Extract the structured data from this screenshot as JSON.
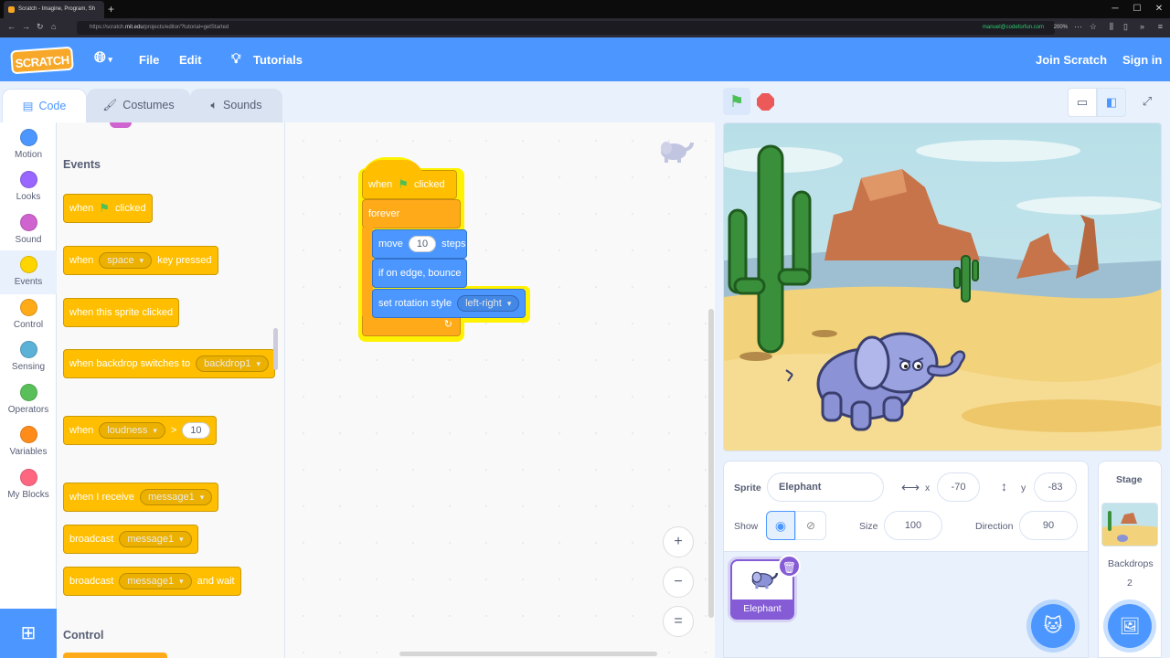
{
  "browser": {
    "tab_title": "Scratch - Imagine, Program, Sh",
    "url_prefix": "https://scratch.",
    "url_domain": "mit.edu",
    "url_suffix": "/projects/editor/?tutorial=getStarted",
    "account": "manuel@codeforfun.com",
    "zoom": "200%"
  },
  "menubar": {
    "logo": "SCRATCH",
    "file": "File",
    "edit": "Edit",
    "tutorials": "Tutorials",
    "join": "Join Scratch",
    "signin": "Sign in"
  },
  "tabs": {
    "code": "Code",
    "costumes": "Costumes",
    "sounds": "Sounds"
  },
  "categories": [
    {
      "label": "Motion",
      "color": "#4c97ff"
    },
    {
      "label": "Looks",
      "color": "#9966ff"
    },
    {
      "label": "Sound",
      "color": "#cf63cf"
    },
    {
      "label": "Events",
      "color": "#ffd500"
    },
    {
      "label": "Control",
      "color": "#ffab19"
    },
    {
      "label": "Sensing",
      "color": "#5cb1d6"
    },
    {
      "label": "Operators",
      "color": "#59c059"
    },
    {
      "label": "Variables",
      "color": "#ff8c1a"
    },
    {
      "label": "My Blocks",
      "color": "#ff6680"
    }
  ],
  "palette": {
    "events_heading": "Events",
    "control_heading": "Control",
    "when": "when",
    "clicked": "clicked",
    "space": "space",
    "key_pressed": "key pressed",
    "sprite_clicked": "when this sprite clicked",
    "backdrop_switches": "when backdrop switches to",
    "backdrop1": "backdrop1",
    "loudness": "loudness",
    "gt": ">",
    "loudness_value": "10",
    "when_i_receive": "when I receive",
    "message1": "message1",
    "broadcast": "broadcast",
    "and_wait": "and wait"
  },
  "script": {
    "when": "when",
    "clicked": "clicked",
    "forever": "forever",
    "move": "move",
    "steps_value": "10",
    "steps": "steps",
    "bounce": "if on edge, bounce",
    "rotation_style": "set rotation style",
    "rotation_value": "left-right"
  },
  "zoom_controls": {
    "in": "+",
    "out": "−",
    "reset": "="
  },
  "sprite_info": {
    "sprite_label": "Sprite",
    "sprite_name": "Elephant",
    "x_label": "x",
    "x_value": "-70",
    "y_label": "y",
    "y_value": "-83",
    "show_label": "Show",
    "size_label": "Size",
    "size_value": "100",
    "direction_label": "Direction",
    "direction_value": "90"
  },
  "sprite_list": [
    {
      "name": "Elephant"
    }
  ],
  "stage_pane": {
    "title": "Stage",
    "backdrops_label": "Backdrops",
    "backdrops_count": "2"
  }
}
